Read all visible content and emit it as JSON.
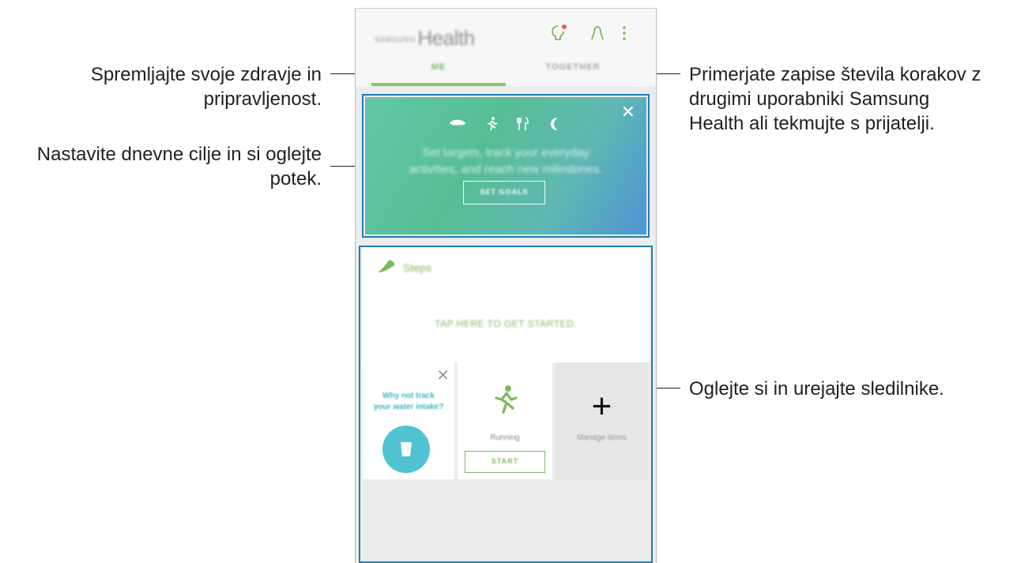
{
  "callouts": {
    "tabs_me": [
      "Spremljajte svoje zdravje in",
      "pripravljenost."
    ],
    "goals": [
      "Nastavite dnevne cilje in si oglejte",
      "potek."
    ],
    "together": [
      "Primerjate zapise števila korakov z",
      "drugimi uporabniki Samsung",
      "Health ali tekmujte s prijatelji."
    ],
    "trackers": [
      "Oglejte si in urejajte sledilnike."
    ]
  },
  "app": {
    "logo_small": "SAMSUNG",
    "logo": "Health",
    "tabs": [
      "ME",
      "TOGETHER"
    ],
    "active_tab": "ME"
  },
  "goals_card": {
    "text": [
      "Set targets, track your everyday",
      "activities, and reach new milestones."
    ],
    "button": "SET GOALS",
    "icons": [
      "shoe-icon",
      "running-icon",
      "food-icon",
      "moon-icon"
    ]
  },
  "steps_card": {
    "title": "Steps",
    "prompt": "TAP HERE TO GET STARTED."
  },
  "tracker_cards": {
    "water_prompt": [
      "Why not track",
      "your water intake?"
    ],
    "running_label": "Running",
    "running_button": "START",
    "manage_label": "Manage items"
  },
  "colors": {
    "accent_green": "#7cb95c",
    "highlight_blue": "#1d7db8",
    "water_teal": "#4fc3d1"
  }
}
